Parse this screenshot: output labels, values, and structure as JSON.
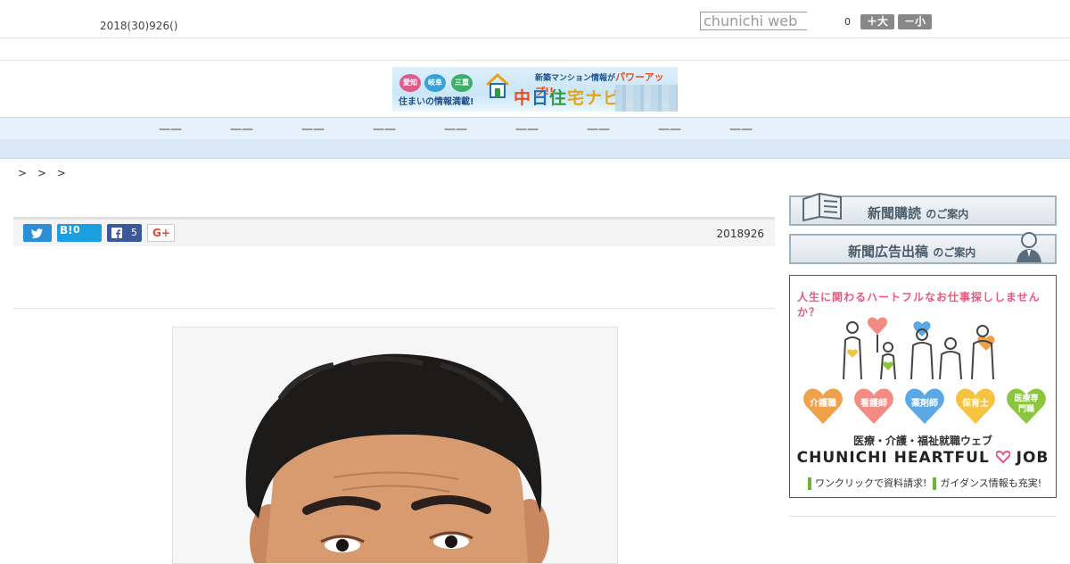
{
  "header": {
    "date": "2018(30)926()",
    "search_placeholder": "chunichi web",
    "font_size_value": "0",
    "font_bigger": "＋大",
    "font_smaller": "－小"
  },
  "banner": {
    "tags": [
      "愛知",
      "岐阜",
      "三重"
    ],
    "subtitle": "住まいの情報満載!",
    "top_text": "新築マンション情報が",
    "top_highlight": "パワーアップ!!",
    "brand_parts": [
      "中",
      "日",
      "住",
      "宅ナビ"
    ]
  },
  "nav": {
    "items": [
      "一一",
      "一一",
      "一一",
      "一一",
      "一一",
      "一一",
      "一一",
      "一一",
      "一一"
    ]
  },
  "breadcrumb": "> > >",
  "share": {
    "twitter_icon": "twitter-icon",
    "hatena_label": "B!",
    "hatena_count": "0",
    "facebook_count": "5",
    "gplus_label": "G+"
  },
  "article": {
    "date": "2018926"
  },
  "sidebar": {
    "subscribe_main": "新聞購読",
    "subscribe_sub": "のご案内",
    "advert_main": "新聞広告出稿",
    "advert_sub": "のご案内",
    "ad": {
      "headline": "人生に関わるハートフルなお仕事探ししませんか？",
      "hearts": [
        {
          "label": "介護職",
          "color": "#f0a04b"
        },
        {
          "label": "看護師",
          "color": "#f28b82"
        },
        {
          "label": "薬剤師",
          "color": "#5aa9e6"
        },
        {
          "label": "保育士",
          "color": "#f5c242"
        },
        {
          "label": "医療専門職",
          "color": "#8cc63f"
        }
      ],
      "line2": "医療・介護・福祉就職ウェブ",
      "line3_a": "CHUNICHI HEARTFUL",
      "line3_b": "JOB",
      "note_a": "ワンクリックで資料請求!",
      "note_b": "ガイダンス情報も充実!"
    }
  }
}
